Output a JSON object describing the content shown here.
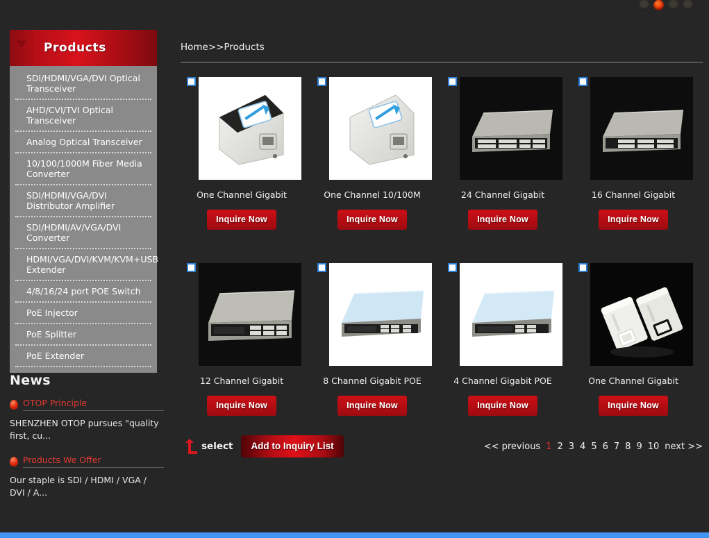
{
  "topbar": {
    "dots": [
      "dot-1",
      "dot-2-active",
      "dot-3",
      "dot-4"
    ],
    "active_index": 1,
    "active_color": "#e8330a"
  },
  "sidebar": {
    "panel_title": "Products",
    "items": [
      {
        "label": "SDI/HDMI/VGA/DVI Optical Transceiver"
      },
      {
        "label": "AHD/CVI/TVI Optical Transceiver"
      },
      {
        "label": "Analog Optical Transceiver"
      },
      {
        "label": "10/100/1000M Fiber Media Converter"
      },
      {
        "label": "SDI/HDMI/VGA/DVI Distributor Amplifier"
      },
      {
        "label": "SDI/HDMI/AV/VGA/DVI Converter"
      },
      {
        "label": "HDMI/VGA/DVI/KVM/KVM+USB Extender"
      },
      {
        "label": "4/8/16/24 port POE Switch"
      },
      {
        "label": "PoE Injector"
      },
      {
        "label": "PoE Splitter"
      },
      {
        "label": "PoE Extender"
      }
    ]
  },
  "news": {
    "heading": "News",
    "items": [
      {
        "title": "OTOP Principle",
        "body": "SHENZHEN OTOP pursues \"quality first, cu..."
      },
      {
        "title": "Products We Offer",
        "body": "Our staple is SDI / HDMI / VGA / DVI / A..."
      }
    ]
  },
  "breadcrumb": {
    "home": "Home",
    "sep": ">>",
    "current": "Products"
  },
  "products": [
    {
      "name": "One Channel Gigabit",
      "button": "Inquire Now",
      "art": "injector",
      "bg": "#ffffff"
    },
    {
      "name": "One Channel 10/100M",
      "button": "Inquire Now",
      "art": "injector",
      "bg": "#ffffff"
    },
    {
      "name": "24 Channel Gigabit",
      "button": "Inquire Now",
      "art": "switch-grey",
      "bg": "#ffffff"
    },
    {
      "name": "16 Channel Gigabit",
      "button": "Inquire Now",
      "art": "switch-grey",
      "bg": "#ffffff"
    },
    {
      "name": "12 Channel Gigabit",
      "button": "Inquire Now",
      "art": "switch-grey",
      "bg": "#ffffff"
    },
    {
      "name": "8 Channel Gigabit POE",
      "button": "Inquire Now",
      "art": "switch-blue",
      "bg": "#ffffff"
    },
    {
      "name": "4 Channel Gigabit POE",
      "button": "Inquire Now",
      "art": "switch-blue",
      "bg": "#ffffff"
    },
    {
      "name": "One Channel Gigabit",
      "button": "Inquire Now",
      "art": "extender-pair",
      "bg": "#0a0a0a"
    }
  ],
  "footer": {
    "select_label": "select",
    "add_button": "Add to Inquiry List",
    "pager": {
      "previous": "<< previous",
      "pages": [
        "1",
        "2",
        "3",
        "4",
        "5",
        "6",
        "7",
        "8",
        "9",
        "10"
      ],
      "current": "1",
      "next": "next >>"
    }
  }
}
